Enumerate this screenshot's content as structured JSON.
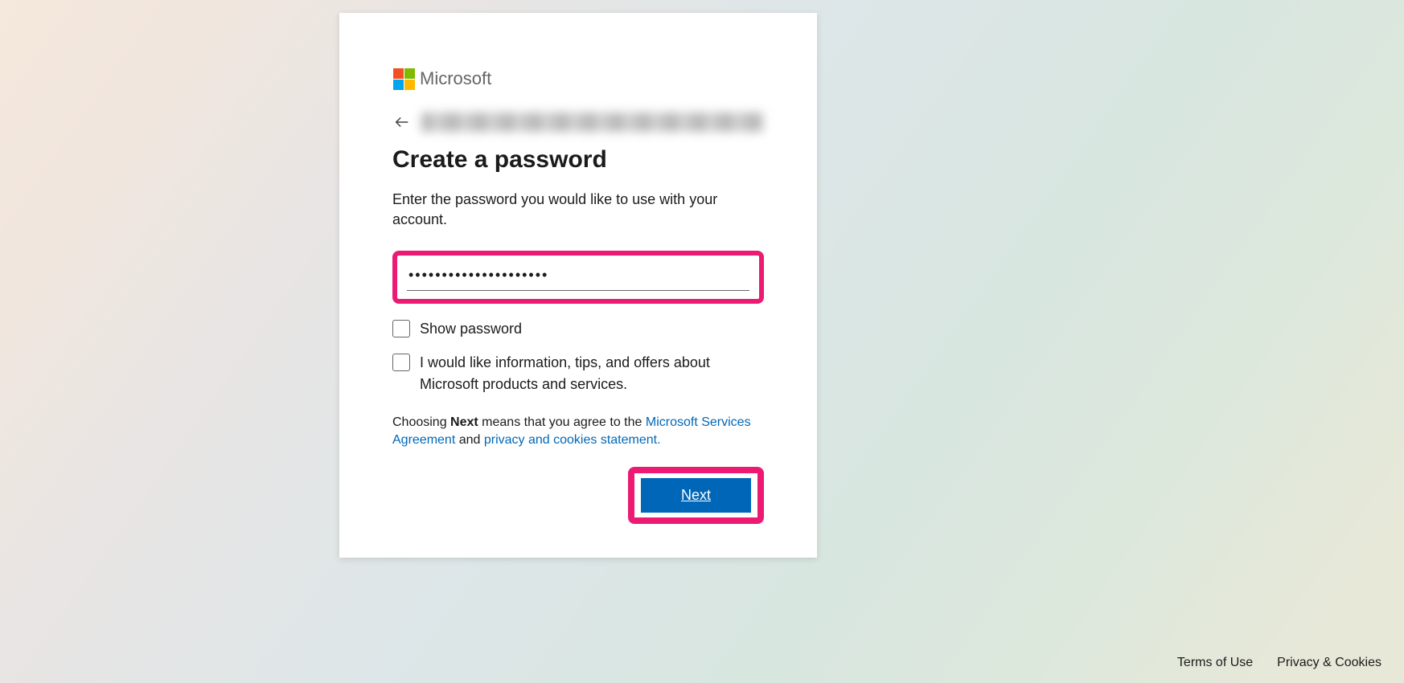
{
  "brand": "Microsoft",
  "title": "Create a password",
  "subtitle": "Enter the password you would like to use with your account.",
  "password_value": "•••••••••••••••••••••",
  "checkboxes": {
    "show_password": "Show password",
    "marketing": "I would like information, tips, and offers about Microsoft products and services."
  },
  "legal": {
    "prefix": "Choosing ",
    "bold": "Next",
    "mid": " means that you agree to the ",
    "link1": "Microsoft Services Agreement",
    "between": " and ",
    "link2": "privacy and cookies statement."
  },
  "next_button": "Next",
  "footer": {
    "terms": "Terms of Use",
    "privacy": "Privacy & Cookies"
  }
}
